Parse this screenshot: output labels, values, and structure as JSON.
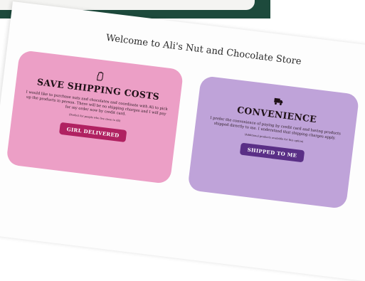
{
  "title": "Welcome to Ali's Nut and Chocolate Store",
  "cards": [
    {
      "icon": "hand-icon",
      "heading": "SAVE SHIPPING COSTS",
      "body": "I would like to purchase nuts and chocolates and coordinate with Ali to pick up the products in person. There will be no shipping charges and I will pay for my order now by credit card.",
      "note": "(Perfect for people who live close to Ali)",
      "button": "GIRL DELIVERED",
      "color": "#ec9fc6",
      "button_color": "#b02161"
    },
    {
      "icon": "truck-icon",
      "heading": "CONVENIENCE",
      "body": "I prefer the convenience of paying by credit card and having products shipped directly to me. I understand that shipping charges apply.",
      "note": "(Additional products available for this option)",
      "button": "SHIPPED TO ME",
      "color": "#bfa3d9",
      "button_color": "#5a2f86"
    }
  ],
  "colors": {
    "header_bar": "#1d4a3c",
    "background": "#ffffff"
  }
}
